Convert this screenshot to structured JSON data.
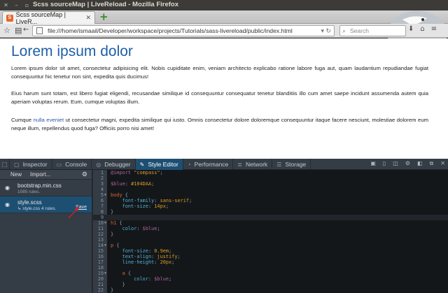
{
  "window": {
    "title": "Scss sourceMap | LiveReload - Mozilla Firefox"
  },
  "tab": {
    "label": "Scss sourceMap | LiveR...",
    "close": "✕",
    "new_tab": "+"
  },
  "nav": {
    "url": "file:///home/ismaail/Developer/workspace/projects/Tutorials/sass-livereload/public/index.html",
    "search_placeholder": "Search"
  },
  "page": {
    "heading": "Lorem ipsum dolor",
    "p1": "Lorem ipsum dolor sit amet, consectetur adipisicing elit. Nobis cupiditate enim, veniam architecto explicabo ratione labore fuga aut, quam laudantium repudiandae fugiat consequuntur hic tenetur non sint, expedita quis ducimus!",
    "p2": "Eius harum sunt totam, est libero fugiat eligendi, recusandae similique id consequuntur consequatur tenetur blanditiis illo cum amet saepe incidunt assumenda autem quia aperiam voluptas rerum. Eum, cumque voluptas illum.",
    "p3_before": "Cumque ",
    "p3_link": "nulla eveniet",
    "p3_after": " ut consectetur magni, expedita similique qui iusto. Omnis consectetur dolore doloremque consequuntur itaque facere nesciunt, molestiae dolorem eum neque illum, repellendus quod fuga? Officiis porro nisi amet!"
  },
  "devtools": {
    "tabs": [
      {
        "label": "Inspector",
        "icon": "inspector-icon"
      },
      {
        "label": "Console",
        "icon": "console-icon"
      },
      {
        "label": "Debugger",
        "icon": "debugger-icon"
      },
      {
        "label": "Style Editor",
        "icon": "style-editor-icon",
        "active": true
      },
      {
        "label": "Performance",
        "icon": "performance-icon"
      },
      {
        "label": "Network",
        "icon": "network-icon"
      },
      {
        "label": "Storage",
        "icon": "storage-icon"
      }
    ],
    "sidebar": {
      "new_label": "New",
      "import_label": "Import...",
      "sheets": [
        {
          "name": "bootstrap.min.css",
          "meta": "1085 rules."
        },
        {
          "name": "style.scss",
          "meta": "↳ style.css  4 rules.",
          "save": "Save"
        }
      ]
    },
    "editor": {
      "lines": [
        "1",
        "2",
        "3",
        "4",
        "5",
        "6",
        "7",
        "8",
        "9",
        "10",
        "11",
        "12",
        "13",
        "14",
        "15",
        "16",
        "17",
        "18",
        "19",
        "20",
        "21",
        "22"
      ]
    }
  }
}
